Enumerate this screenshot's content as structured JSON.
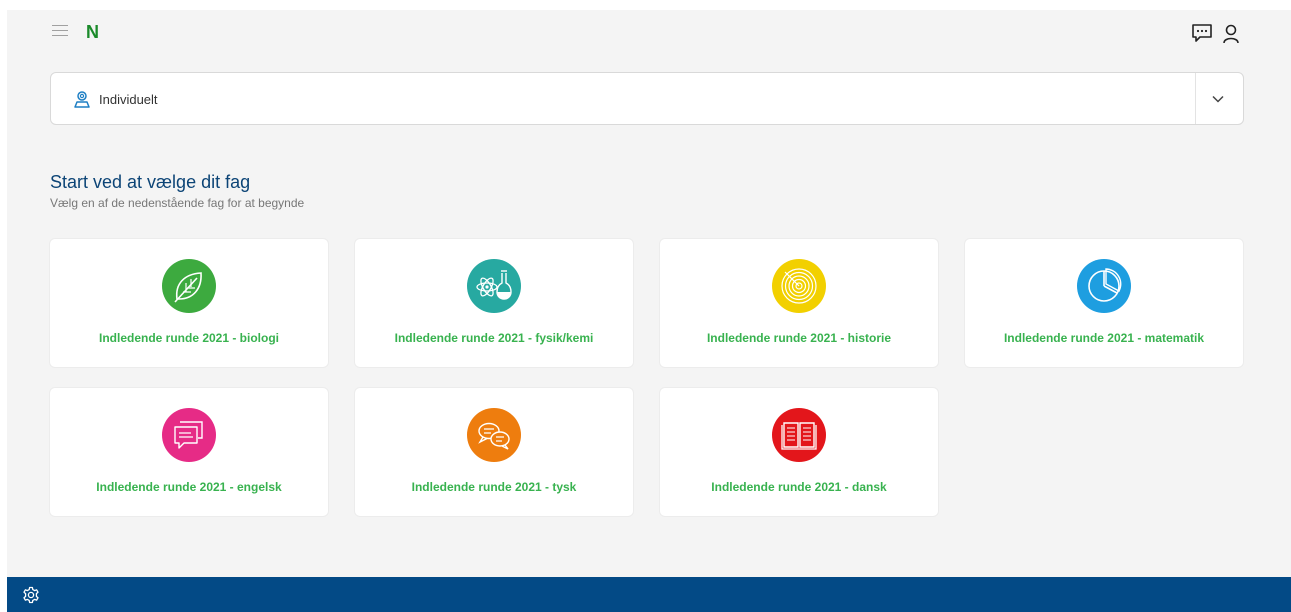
{
  "header": {
    "logo_text": "N",
    "icons": {
      "menu": "hamburger-menu-icon",
      "chat": "chat-icon",
      "user": "user-icon"
    }
  },
  "mode_select": {
    "value": "Individuelt",
    "icon": "person-badge-icon"
  },
  "intro": {
    "title": "Start ved at vælge dit fag",
    "subtitle": "Vælg en af de nedenstående fag for at begynde"
  },
  "subjects": [
    {
      "label": "Indledende runde 2021 - biologi",
      "color": "#3daa3f",
      "icon": "leaf-icon"
    },
    {
      "label": "Indledende runde 2021 - fysik/kemi",
      "color": "#27a9a1",
      "icon": "atom-flask-icon"
    },
    {
      "label": "Indledende runde 2021 - historie",
      "color": "#f2d000",
      "icon": "spiral-target-icon"
    },
    {
      "label": "Indledende runde 2021 - matematik",
      "color": "#1e9ee0",
      "icon": "pie-chart-icon"
    },
    {
      "label": "Indledende runde 2021 - engelsk",
      "color": "#e62b86",
      "icon": "speech-bubbles-icon"
    },
    {
      "label": "Indledende runde 2021 - tysk",
      "color": "#ee7d0e",
      "icon": "chat-bubbles-icon"
    },
    {
      "label": "Indledende runde 2021 - dansk",
      "color": "#e3161b",
      "icon": "open-book-icon"
    }
  ],
  "theme": {
    "accent_green": "#38b24f",
    "heading_blue": "#0c4476",
    "footer_blue": "#034a86"
  },
  "footer": {
    "icon": "gear-icon"
  }
}
